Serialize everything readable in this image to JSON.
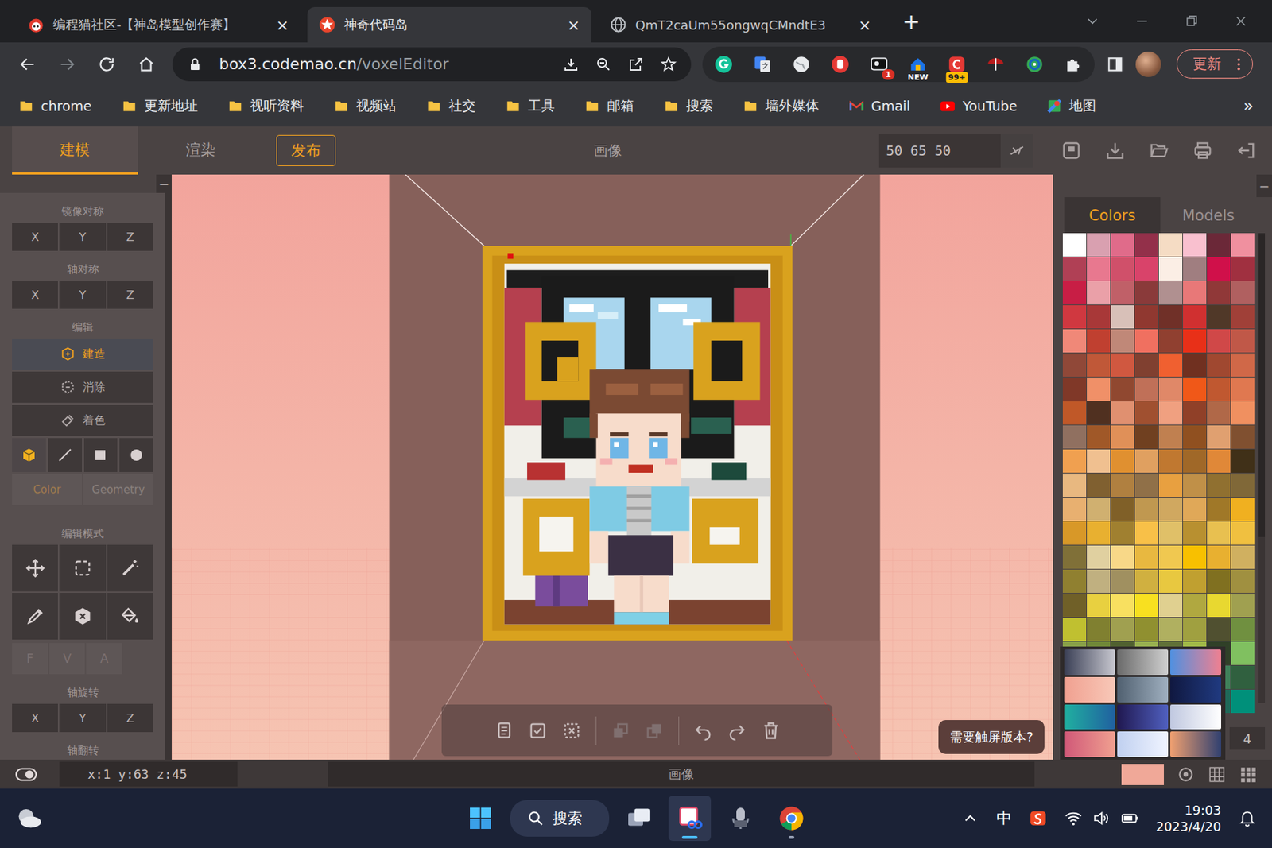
{
  "browser": {
    "tabs": [
      {
        "title": "编程猫社区-【神岛模型创作赛】",
        "kind": "codemao",
        "selected": false,
        "close": "×"
      },
      {
        "title": "神奇代码岛",
        "kind": "box3",
        "selected": true,
        "close": "×"
      },
      {
        "title": "QmT2caUm55ongwqCMndtE3",
        "kind": "globe",
        "selected": false,
        "close": "×"
      }
    ],
    "new_tab": "+",
    "url": {
      "host": "box3.codemao.cn",
      "path": "/voxelEditor"
    },
    "extensions": [
      {
        "kind": "grammarly",
        "badge": ""
      },
      {
        "kind": "translate",
        "badge": ""
      },
      {
        "kind": "globe",
        "badge": ""
      },
      {
        "kind": "hand",
        "badge": ""
      },
      {
        "kind": "screen",
        "badge": "1"
      },
      {
        "kind": "news",
        "badge": "NEW"
      },
      {
        "kind": "clip",
        "badge": "99+"
      },
      {
        "kind": "umbrella",
        "badge": ""
      },
      {
        "kind": "gear",
        "badge": ""
      },
      {
        "kind": "puzzle",
        "badge": ""
      }
    ],
    "update_button": "更新",
    "bookmarks": [
      {
        "label": "chrome",
        "kind": "folder"
      },
      {
        "label": "更新地址",
        "kind": "folder"
      },
      {
        "label": "视听资料",
        "kind": "folder"
      },
      {
        "label": "视频站",
        "kind": "folder"
      },
      {
        "label": "社交",
        "kind": "folder"
      },
      {
        "label": "工具",
        "kind": "folder"
      },
      {
        "label": "邮箱",
        "kind": "folder"
      },
      {
        "label": "搜索",
        "kind": "folder"
      },
      {
        "label": "墙外媒体",
        "kind": "folder"
      },
      {
        "label": "Gmail",
        "kind": "gmail"
      },
      {
        "label": "YouTube",
        "kind": "youtube"
      },
      {
        "label": "地图",
        "kind": "maps"
      }
    ],
    "bookmarks_more": "»"
  },
  "app": {
    "tabs": [
      {
        "label": "建模",
        "kind": "tab",
        "selected": true
      },
      {
        "label": "渲染",
        "kind": "tab",
        "selected": false
      },
      {
        "label": "发布",
        "kind": "button",
        "selected": false
      }
    ],
    "title": "画像",
    "size_field": "50 65 50",
    "left_panel": {
      "collapse": "−",
      "mirror": {
        "label": "镜像对称",
        "axes": [
          "X",
          "Y",
          "Z"
        ]
      },
      "axis_symmetry": {
        "label": "轴对称",
        "axes": [
          "X",
          "Y",
          "Z"
        ]
      },
      "edit": {
        "label": "编辑",
        "actions": [
          {
            "label": "建造",
            "kind": "build",
            "selected": true
          },
          {
            "label": "消除",
            "kind": "erase",
            "selected": false
          },
          {
            "label": "着色",
            "kind": "paint",
            "selected": false
          }
        ]
      },
      "brushes": [
        {
          "kind": "cube",
          "selected": true
        },
        {
          "kind": "line",
          "selected": false
        },
        {
          "kind": "square",
          "selected": false
        },
        {
          "kind": "circle",
          "selected": false
        }
      ],
      "paint_tabs": [
        {
          "label": "Color",
          "selected": true,
          "disabled": true
        },
        {
          "label": "Geometry",
          "selected": false,
          "disabled": true
        }
      ],
      "edit_mode": {
        "label": "编辑模式",
        "tools": [
          {
            "kind": "move",
            "selected": false
          },
          {
            "kind": "select",
            "selected": false
          },
          {
            "kind": "wand",
            "selected": false
          },
          {
            "kind": "picker",
            "selected": false
          },
          {
            "kind": "erase",
            "selected": false
          },
          {
            "kind": "fill",
            "selected": false
          }
        ]
      },
      "fva": [
        {
          "label": "F",
          "disabled": true
        },
        {
          "label": "V",
          "disabled": true
        },
        {
          "label": "A",
          "disabled": true
        }
      ],
      "rotate": {
        "label": "轴旋转",
        "axes": [
          "X",
          "Y",
          "Z"
        ]
      },
      "flip": {
        "label": "轴翻转"
      }
    },
    "floating_toolbar": {
      "groups": [
        [
          {
            "kind": "copy",
            "disabled": false
          },
          {
            "kind": "paste",
            "disabled": false
          },
          {
            "kind": "cut",
            "disabled": false
          }
        ],
        [
          {
            "kind": "layer-down",
            "disabled": true
          },
          {
            "kind": "layer-up",
            "disabled": true
          }
        ],
        [
          {
            "kind": "undo",
            "disabled": false
          },
          {
            "kind": "redo",
            "disabled": false
          },
          {
            "kind": "trash",
            "disabled": false
          }
        ]
      ]
    },
    "touch_hint": "需要触屏版本?",
    "right_panel": {
      "collapse": "−",
      "tabs": [
        {
          "label": "Colors",
          "selected": true
        },
        {
          "label": "Models",
          "selected": false
        }
      ],
      "palette": [
        {
          "color": "#ffffff"
        },
        {
          "color": "#d9a0b0"
        },
        {
          "color": "#e06b8a"
        },
        {
          "color": "#93304a"
        },
        {
          "color": "#f5dcc4"
        },
        {
          "color": "#f9c0cf"
        },
        {
          "color": "#6b2838"
        },
        {
          "color": "#f0909f"
        },
        {
          "color": "#b04055"
        },
        {
          "color": "#e8788f"
        },
        {
          "color": "#d0506a"
        },
        {
          "color": "#d9436a"
        },
        {
          "color": "#fbeee5"
        },
        {
          "color": "#a07e80"
        },
        {
          "color": "#d0104a"
        },
        {
          "color": "#a03040"
        },
        {
          "color": "#c81e45"
        },
        {
          "color": "#eaa0a8"
        },
        {
          "color": "#c06068"
        },
        {
          "color": "#8a3a3a"
        },
        {
          "color": "#b09090"
        },
        {
          "color": "#e87878"
        },
        {
          "color": "#903838"
        },
        {
          "color": "#b06060"
        },
        {
          "color": "#d03840"
        },
        {
          "color": "#a83838"
        },
        {
          "color": "#d8c0b8"
        },
        {
          "color": "#903830"
        },
        {
          "color": "#703028"
        },
        {
          "color": "#d03030"
        },
        {
          "color": "#503828"
        },
        {
          "color": "#a04038"
        },
        {
          "color": "#f08878"
        },
        {
          "color": "#c04030"
        },
        {
          "color": "#c08878"
        },
        {
          "color": "#f07060"
        },
        {
          "color": "#904030"
        },
        {
          "color": "#e83018"
        },
        {
          "color": "#d04848"
        },
        {
          "color": "#c05848"
        },
        {
          "color": "#904838"
        },
        {
          "color": "#c05838"
        },
        {
          "color": "#d05840"
        },
        {
          "color": "#804030"
        },
        {
          "color": "#f06030"
        },
        {
          "color": "#703020"
        },
        {
          "color": "#a04830"
        },
        {
          "color": "#d06848"
        },
        {
          "color": "#803828"
        },
        {
          "color": "#f09068"
        },
        {
          "color": "#904830"
        },
        {
          "color": "#c07058"
        },
        {
          "color": "#e08868"
        },
        {
          "color": "#f05818"
        },
        {
          "color": "#c05830"
        },
        {
          "color": "#e07850"
        },
        {
          "color": "#c05828"
        },
        {
          "color": "#503020"
        },
        {
          "color": "#e09070"
        },
        {
          "color": "#a05030"
        },
        {
          "color": "#f0a080"
        },
        {
          "color": "#904028"
        },
        {
          "color": "#b06848"
        },
        {
          "color": "#f09060"
        },
        {
          "color": "#907060"
        },
        {
          "color": "#a05828"
        },
        {
          "color": "#e09058"
        },
        {
          "color": "#704020"
        },
        {
          "color": "#c08050"
        },
        {
          "color": "#905020"
        },
        {
          "color": "#e0a070"
        },
        {
          "color": "#805030"
        },
        {
          "color": "#f0a050"
        },
        {
          "color": "#f0c090"
        },
        {
          "color": "#e09030"
        },
        {
          "color": "#e0a060"
        },
        {
          "color": "#c07830"
        },
        {
          "color": "#a06828"
        },
        {
          "color": "#e08838"
        },
        {
          "color": "#403018"
        },
        {
          "color": "#e8b880"
        },
        {
          "color": "#806030"
        },
        {
          "color": "#b08040"
        },
        {
          "color": "#907048"
        },
        {
          "color": "#e8a040"
        },
        {
          "color": "#c09048"
        },
        {
          "color": "#907030"
        },
        {
          "color": "#806838"
        },
        {
          "color": "#e8b070"
        },
        {
          "color": "#d0b070"
        },
        {
          "color": "#806028"
        },
        {
          "color": "#c09850"
        },
        {
          "color": "#d0a860"
        },
        {
          "color": "#e0a858"
        },
        {
          "color": "#a07828"
        },
        {
          "color": "#f0b020"
        },
        {
          "color": "#d89828"
        },
        {
          "color": "#e8b030"
        },
        {
          "color": "#a08030"
        },
        {
          "color": "#f8c048"
        },
        {
          "color": "#e0c068"
        },
        {
          "color": "#b89030"
        },
        {
          "color": "#e8c050"
        },
        {
          "color": "#f0c040"
        },
        {
          "color": "#807038"
        },
        {
          "color": "#e0d0a0"
        },
        {
          "color": "#f8d888"
        },
        {
          "color": "#e8b840"
        },
        {
          "color": "#f0c850"
        },
        {
          "color": "#f8c000"
        },
        {
          "color": "#e8b030"
        },
        {
          "color": "#d0b060"
        },
        {
          "color": "#908030"
        },
        {
          "color": "#c0b080"
        },
        {
          "color": "#a09060"
        },
        {
          "color": "#d0b040"
        },
        {
          "color": "#e8c840"
        },
        {
          "color": "#c0a030"
        },
        {
          "color": "#807020"
        },
        {
          "color": "#a09040"
        },
        {
          "color": "#706028"
        },
        {
          "color": "#e8d040"
        },
        {
          "color": "#f8e060"
        },
        {
          "color": "#f8e020"
        },
        {
          "color": "#e0d090"
        },
        {
          "color": "#b0a840"
        },
        {
          "color": "#e8d830"
        },
        {
          "color": "#a0a050"
        },
        {
          "color": "#c0c030"
        },
        {
          "color": "#808030"
        },
        {
          "color": "#a0a050"
        },
        {
          "color": "#909030"
        },
        {
          "color": "#b0b060"
        },
        {
          "color": "#a0a040"
        },
        {
          "color": "#505030"
        },
        {
          "color": "#709040"
        },
        {
          "color": "#88a048"
        },
        {
          "color": "#708838"
        },
        {
          "color": "#506030"
        },
        {
          "color": "#98b050"
        },
        {
          "color": "#607038"
        },
        {
          "color": "#a0b848"
        },
        {
          "color": "#304028"
        },
        {
          "color": "#80c060"
        },
        {
          "color": "#406030"
        },
        {
          "color": "#68a048"
        },
        {
          "color": "#305830"
        },
        {
          "color": "#50a060"
        },
        {
          "color": "#88c080"
        },
        {
          "color": "#307048"
        },
        {
          "color": "#40805a"
        },
        {
          "color": "#30603f"
        },
        {
          "color": "#209060"
        },
        {
          "color": "#50b090"
        },
        {
          "color": "#108070"
        },
        {
          "color": "#40a088"
        },
        {
          "color": "#007060"
        },
        {
          "color": "#309080"
        },
        {
          "color": "#206858"
        },
        {
          "color": "#00907a"
        }
      ],
      "gradients": [
        {
          "colors": [
            "#3a3f55",
            "#c8c8d0"
          ]
        },
        {
          "colors": [
            "#6a6a6a",
            "#d0d0d0"
          ]
        },
        {
          "colors": [
            "#5090e0",
            "#f08090"
          ]
        },
        {
          "colors": [
            "#f0a090",
            "#f8c8b8"
          ]
        },
        {
          "colors": [
            "#506070",
            "#a0b0c0"
          ]
        },
        {
          "colors": [
            "#101840",
            "#203a80"
          ]
        },
        {
          "colors": [
            "#20b0a0",
            "#2060a0"
          ]
        },
        {
          "colors": [
            "#201850",
            "#5060c0"
          ]
        },
        {
          "colors": [
            "#c0c8e0",
            "#ffffff"
          ]
        },
        {
          "colors": [
            "#d05878",
            "#f0a090"
          ]
        },
        {
          "colors": [
            "#c0d0f0",
            "#f0f4ff"
          ]
        },
        {
          "colors": [
            "#f0a070",
            "#304070"
          ]
        }
      ],
      "gradient_page": "4"
    },
    "status": {
      "coords": "x:1 y:63 z:45",
      "title": "画像",
      "current_color": "#f0a898"
    }
  },
  "taskbar": {
    "search": "搜索",
    "apps": [
      {
        "kind": "start",
        "focused": false,
        "running": false
      },
      {
        "kind": "taskview",
        "focused": false,
        "running": false
      },
      {
        "kind": "snip",
        "focused": true,
        "running": true
      },
      {
        "kind": "mic",
        "focused": false,
        "running": false
      },
      {
        "kind": "chrome",
        "focused": false,
        "running": true
      }
    ],
    "ime": "中",
    "time": "19:03",
    "date": "2023/4/20"
  }
}
